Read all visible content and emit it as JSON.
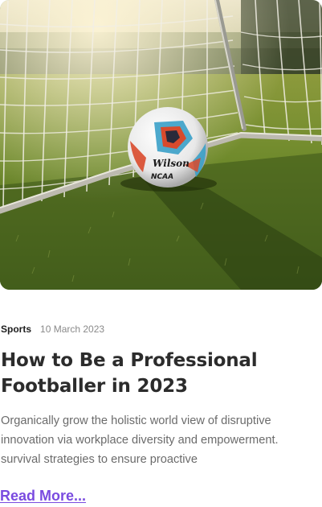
{
  "post": {
    "image": {
      "subject": "soccer ball in goal net on grass",
      "ball_brand_text": "Wilson",
      "ball_league_text": "NCAA"
    },
    "category": "Sports",
    "date": "10 March 2023",
    "title": "How to Be a Professional Footballer in 2023",
    "excerpt": "Organically grow the holistic world view of disruptive innovation via workplace diversity and empowerment. survival strategies to ensure proactive",
    "read_more_label": "Read More..."
  },
  "colors": {
    "accent": "#7a4be0",
    "title": "#2c2c2c",
    "body_text": "#6b6b6b",
    "date": "#8a8a8a"
  }
}
